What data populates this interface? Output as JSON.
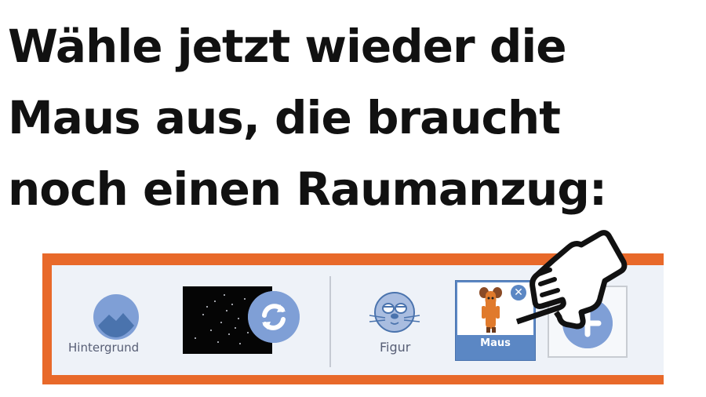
{
  "instruction": {
    "lines": [
      "Wähle jetzt wieder die",
      "Maus aus, die braucht",
      "noch einen Raumanzug:"
    ]
  },
  "toolbar": {
    "background_label": "Hintergrund",
    "sprite_label": "Figur",
    "selected_sprite_label": "Maus",
    "delete_symbol": "✕",
    "accent_color": "#e8692a",
    "button_color": "#7f9fd6",
    "selected_color": "#5b87c4"
  },
  "icons": {
    "background": "mountain-landscape-icon",
    "switch": "rotate-arrows-icon",
    "sprite": "seal-face-icon",
    "add": "plus-icon",
    "pointer": "pointing-hand-icon"
  }
}
